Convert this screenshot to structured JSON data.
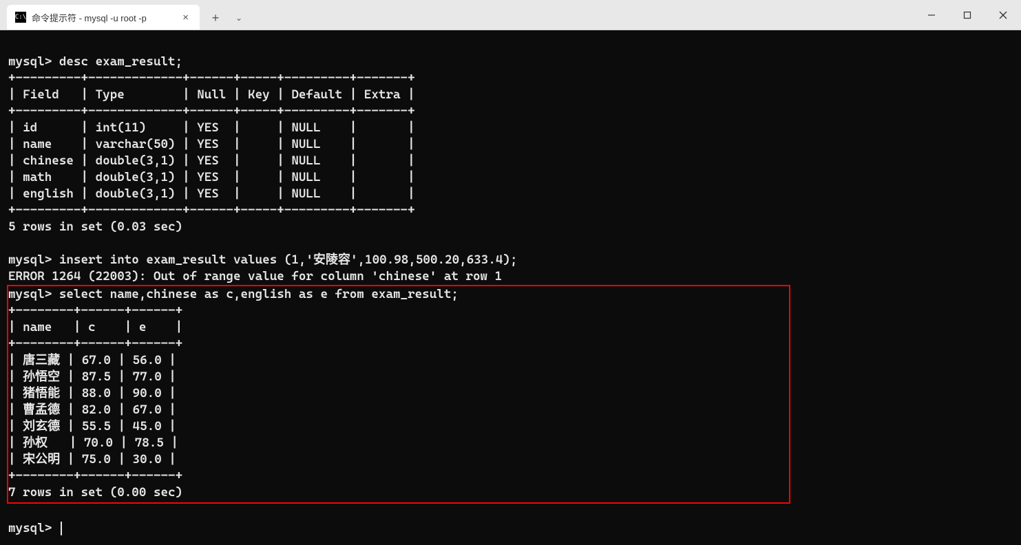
{
  "tab": {
    "title": "命令提示符 - mysql  -u root -p"
  },
  "terminal": {
    "line1_prompt": "mysql> ",
    "line1_cmd": "desc exam_result;",
    "desc_border": "+---------+-------------+------+-----+---------+-------+",
    "desc_header": "| Field   | Type        | Null | Key | Default | Extra |",
    "desc_row1": "| id      | int(11)     | YES  |     | NULL    |       |",
    "desc_row2": "| name    | varchar(50) | YES  |     | NULL    |       |",
    "desc_row3": "| chinese | double(3,1) | YES  |     | NULL    |       |",
    "desc_row4": "| math    | double(3,1) | YES  |     | NULL    |       |",
    "desc_row5": "| english | double(3,1) | YES  |     | NULL    |       |",
    "desc_summary": "5 rows in set (0.03 sec)",
    "line2_prompt": "mysql> ",
    "line2_cmd": "insert into exam_result values (1,'安陵容',100.98,500.20,633.4);",
    "error_line": "ERROR 1264 (22003): Out of range value for column 'chinese' at row 1",
    "line3_prompt": "mysql> ",
    "line3_cmd": "select name,chinese as c,english as e from exam_result;",
    "sel_border": "+--------+------+------+",
    "sel_header": "| name   | c    | e    |",
    "sel_row1": "| 唐三藏 | 67.0 | 56.0 |",
    "sel_row2": "| 孙悟空 | 87.5 | 77.0 |",
    "sel_row3": "| 猪悟能 | 88.0 | 90.0 |",
    "sel_row4": "| 曹孟德 | 82.0 | 67.0 |",
    "sel_row5": "| 刘玄德 | 55.5 | 45.0 |",
    "sel_row6": "| 孙权   | 70.0 | 78.5 |",
    "sel_row7": "| 宋公明 | 75.0 | 30.0 |",
    "sel_summary": "7 rows in set (0.00 sec)",
    "last_prompt": "mysql> "
  }
}
